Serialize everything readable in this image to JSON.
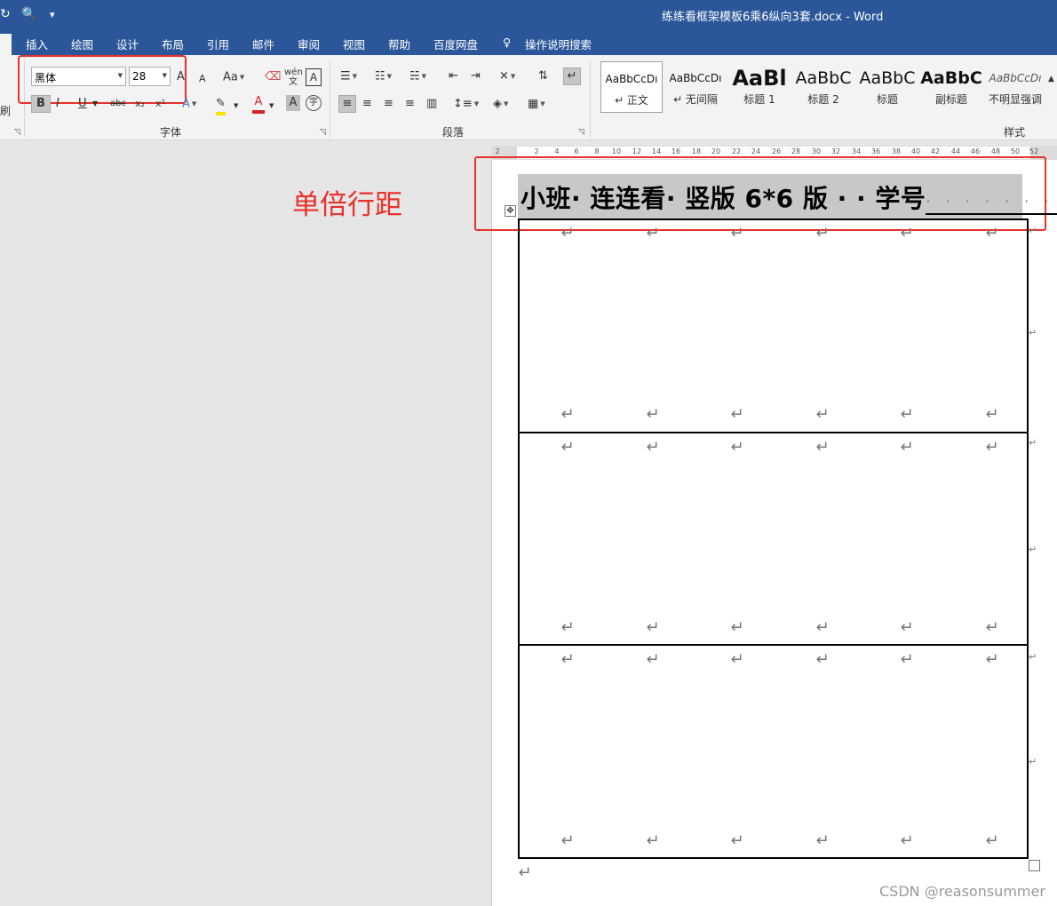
{
  "window": {
    "title": "练练看框架模板6乘6纵向3套.docx  -  Word"
  },
  "quick_access": {
    "redo_icon": "redo-icon",
    "print_preview_icon": "print-preview-icon",
    "customize_icon": "customize-icon"
  },
  "tabs": [
    "插入",
    "绘图",
    "设计",
    "布局",
    "引用",
    "邮件",
    "审阅",
    "视图",
    "帮助",
    "百度网盘",
    "操作说明搜索"
  ],
  "ribbon": {
    "clipboard_fragment": "刷",
    "font": {
      "name": "黑体",
      "size": "28",
      "group_label": "字体",
      "grow_font": "A",
      "shrink_font": "A",
      "change_case": "Aa",
      "bold": "B",
      "italic": "I",
      "underline": "U",
      "strikethrough": "abc",
      "subscript": "x₂",
      "superscript": "x²",
      "text_effects": "A",
      "font_color": "A",
      "char_shading": "A",
      "enclose_char": "字",
      "char_border": "A",
      "phonetic": "wén文"
    },
    "paragraph": {
      "group_label": "段落"
    },
    "styles": {
      "group_label": "样式",
      "items": [
        {
          "sample": "AaBbCcDı",
          "name": "↵ 正文"
        },
        {
          "sample": "AaBbCcDı",
          "name": "↵ 无间隔"
        },
        {
          "sample": "AaBl",
          "name": "标题 1"
        },
        {
          "sample": "AaBbC",
          "name": "标题 2"
        },
        {
          "sample": "AaBbC",
          "name": "标题"
        },
        {
          "sample": "AaBbC",
          "name": "副标题"
        },
        {
          "sample": "AaBbCcDı",
          "name": "不明显强调"
        }
      ]
    }
  },
  "ruler": {
    "ticks": [
      "2",
      "2",
      "4",
      "6",
      "8",
      "10",
      "12",
      "14",
      "16",
      "18",
      "20",
      "22",
      "24",
      "26",
      "28",
      "30",
      "32",
      "34",
      "36",
      "38",
      "40",
      "42",
      "44",
      "46",
      "48",
      "50",
      "52"
    ]
  },
  "annotation": {
    "label": "单倍行距"
  },
  "document": {
    "heading_main": "小班· 连连看· 竖版 6*6 版 · · 学号",
    "heading_dots": "· · · · · · · ·",
    "paragraph_mark": "↵"
  },
  "watermark": "CSDN @reasonsummer",
  "colors": {
    "title_bar": "#2b579a",
    "annotation_red": "#e8312a",
    "heading_shading": "#c8c8c8"
  }
}
